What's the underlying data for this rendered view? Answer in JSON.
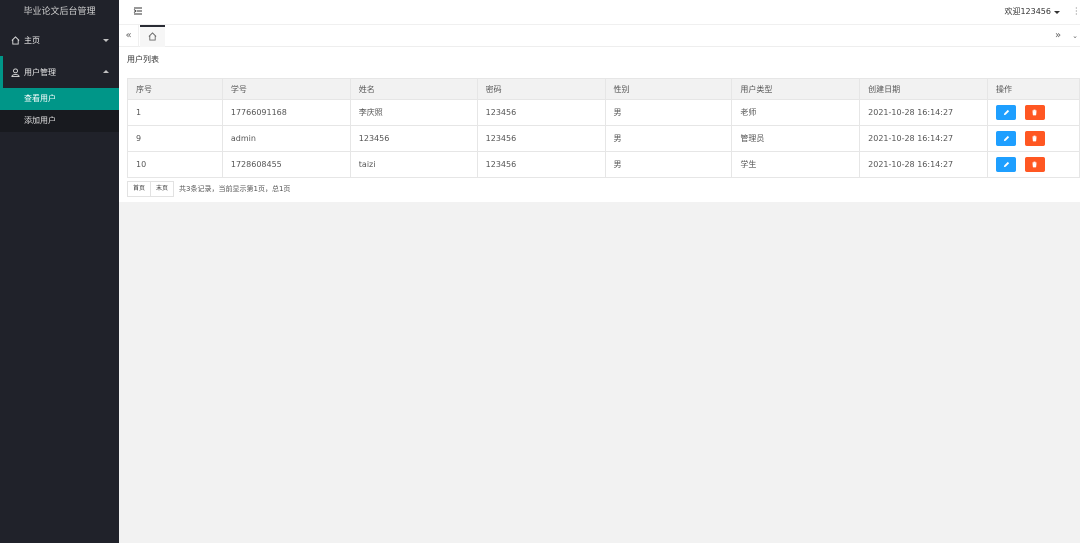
{
  "app": {
    "title": "毕业论文后台管理"
  },
  "sidebar": {
    "items": [
      {
        "label": "主页",
        "icon": "home-icon",
        "expanded": false
      },
      {
        "label": "用户管理",
        "icon": "user-icon",
        "expanded": true,
        "children": [
          {
            "label": "查看用户",
            "active": true
          },
          {
            "label": "添加用户",
            "active": false
          }
        ]
      }
    ]
  },
  "header": {
    "user_label": "欢迎123456"
  },
  "card": {
    "title": "用户列表"
  },
  "table": {
    "columns": [
      "序号",
      "学号",
      "姓名",
      "密码",
      "性别",
      "用户类型",
      "创建日期",
      "操作"
    ],
    "rows": [
      [
        "1",
        "17766091168",
        "李庆照",
        "123456",
        "男",
        "老师",
        "2021-10-28 16:14:27"
      ],
      [
        "9",
        "admin",
        "123456",
        "123456",
        "男",
        "管理员",
        "2021-10-28 16:14:27"
      ],
      [
        "10",
        "1728608455",
        "taizi",
        "123456",
        "男",
        "学生",
        "2021-10-28 16:14:27"
      ]
    ]
  },
  "pager": {
    "first_label": "首页",
    "last_label": "末页",
    "info": "共3条记录，当前显示第1页，总1页"
  },
  "colors": {
    "sidebar_bg": "#20222a",
    "accent": "#009688",
    "edit_btn": "#1e9fff",
    "delete_btn": "#ff5722"
  }
}
